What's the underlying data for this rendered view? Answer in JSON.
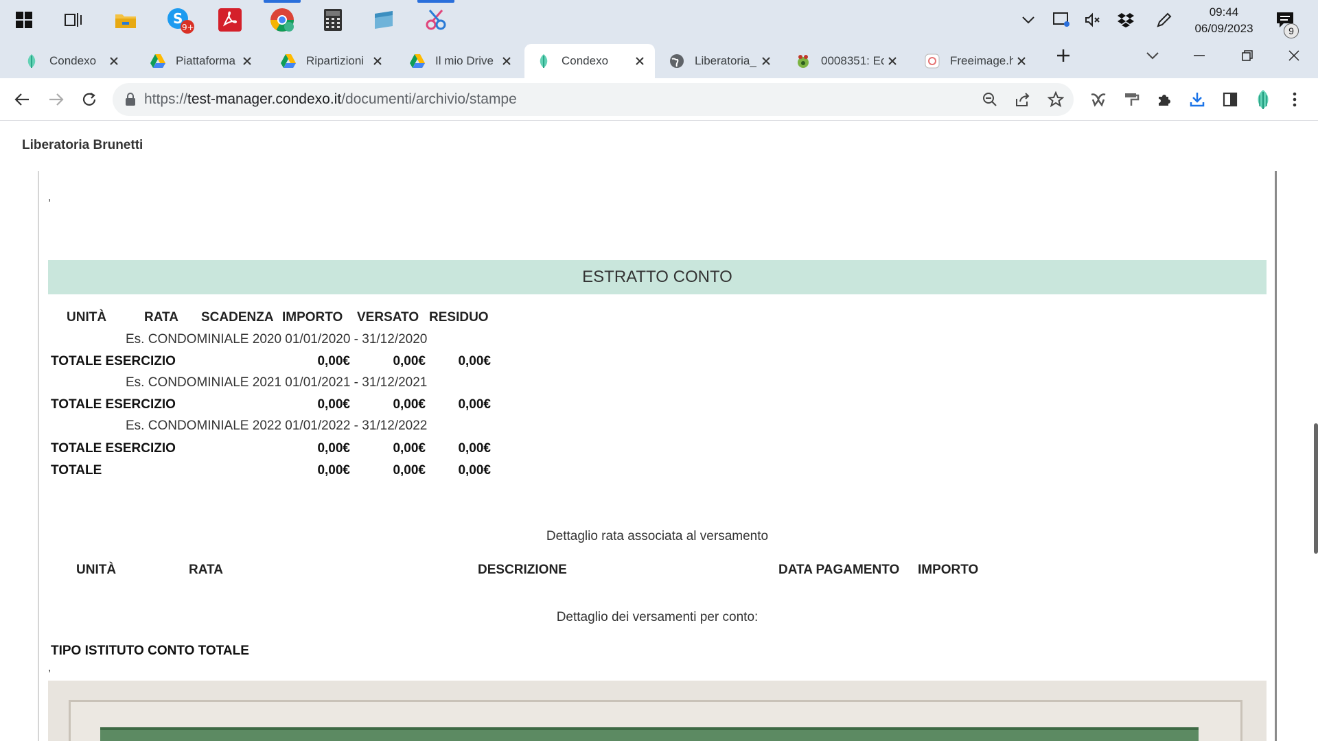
{
  "taskbar": {
    "apps": [
      {
        "icon": "windows-start-icon"
      },
      {
        "icon": "task-view-icon"
      },
      {
        "icon": "file-explorer-icon"
      },
      {
        "icon": "skype-icon",
        "badge": "9+"
      },
      {
        "icon": "acrobat-icon"
      },
      {
        "icon": "chrome-icon"
      },
      {
        "icon": "calculator-icon"
      },
      {
        "icon": "notes-icon"
      },
      {
        "icon": "snipping-tool-icon"
      }
    ],
    "clock_time": "09:44",
    "clock_date": "06/09/2023",
    "notification_count": "9"
  },
  "tabs": [
    {
      "title": "Condexo",
      "icon": "condexo-icon",
      "active": false
    },
    {
      "title": "Piattaforma",
      "icon": "drive-icon",
      "active": false
    },
    {
      "title": "Ripartizioni",
      "icon": "drive-icon",
      "active": false
    },
    {
      "title": "Il mio Drive",
      "icon": "drive-icon",
      "active": false
    },
    {
      "title": "Condexo",
      "icon": "condexo-icon",
      "active": true
    },
    {
      "title": "Liberatoria_",
      "icon": "globe-icon",
      "active": false
    },
    {
      "title": "0008351: Ec",
      "icon": "bug-icon",
      "active": false
    },
    {
      "title": "Freeimage.h",
      "icon": "freeimage-icon",
      "active": false
    }
  ],
  "address_bar": {
    "scheme": "https://",
    "host": "test-manager.condexo.it",
    "path": "/documenti/archivio/stampe"
  },
  "document": {
    "title": "Liberatoria Brunetti",
    "comma_mark": ",",
    "estratto_title": "ESTRATTO CONTO",
    "headers": [
      "UNITÀ",
      "RATA",
      "SCADENZA",
      "IMPORTO",
      "VERSATO",
      "RESIDUO"
    ],
    "exercises": [
      {
        "label": "Es. CONDOMINIALE 2020 01/01/2020 - 31/12/2020",
        "total_label": "TOTALE ESERCIZIO",
        "importo": "0,00€",
        "versato": "0,00€",
        "residuo": "0,00€"
      },
      {
        "label": "Es. CONDOMINIALE 2021 01/01/2021 - 31/12/2021",
        "total_label": "TOTALE ESERCIZIO",
        "importo": "0,00€",
        "versato": "0,00€",
        "residuo": "0,00€"
      },
      {
        "label": "Es. CONDOMINIALE 2022 01/01/2022 - 31/12/2022",
        "total_label": "TOTALE ESERCIZIO",
        "importo": "0,00€",
        "versato": "0,00€",
        "residuo": "0,00€"
      }
    ],
    "grand_total": {
      "label": "TOTALE",
      "importo": "0,00€",
      "versato": "0,00€",
      "residuo": "0,00€"
    },
    "detail_rata_title": "Dettaglio rata associata al versamento",
    "detail_headers": [
      "UNITÀ",
      "RATA",
      "DESCRIZIONE",
      "DATA PAGAMENTO",
      "IMPORTO"
    ],
    "detail_versamenti_title": "Dettaglio dei versamenti per conto:",
    "tipo_istituto_header": "TIPO ISTITUTO CONTO TOTALE"
  },
  "colors": {
    "estratto_band": "#c9e6dc",
    "chrome_frame": "#dfe6ef",
    "accent": "#2a6fdb"
  }
}
